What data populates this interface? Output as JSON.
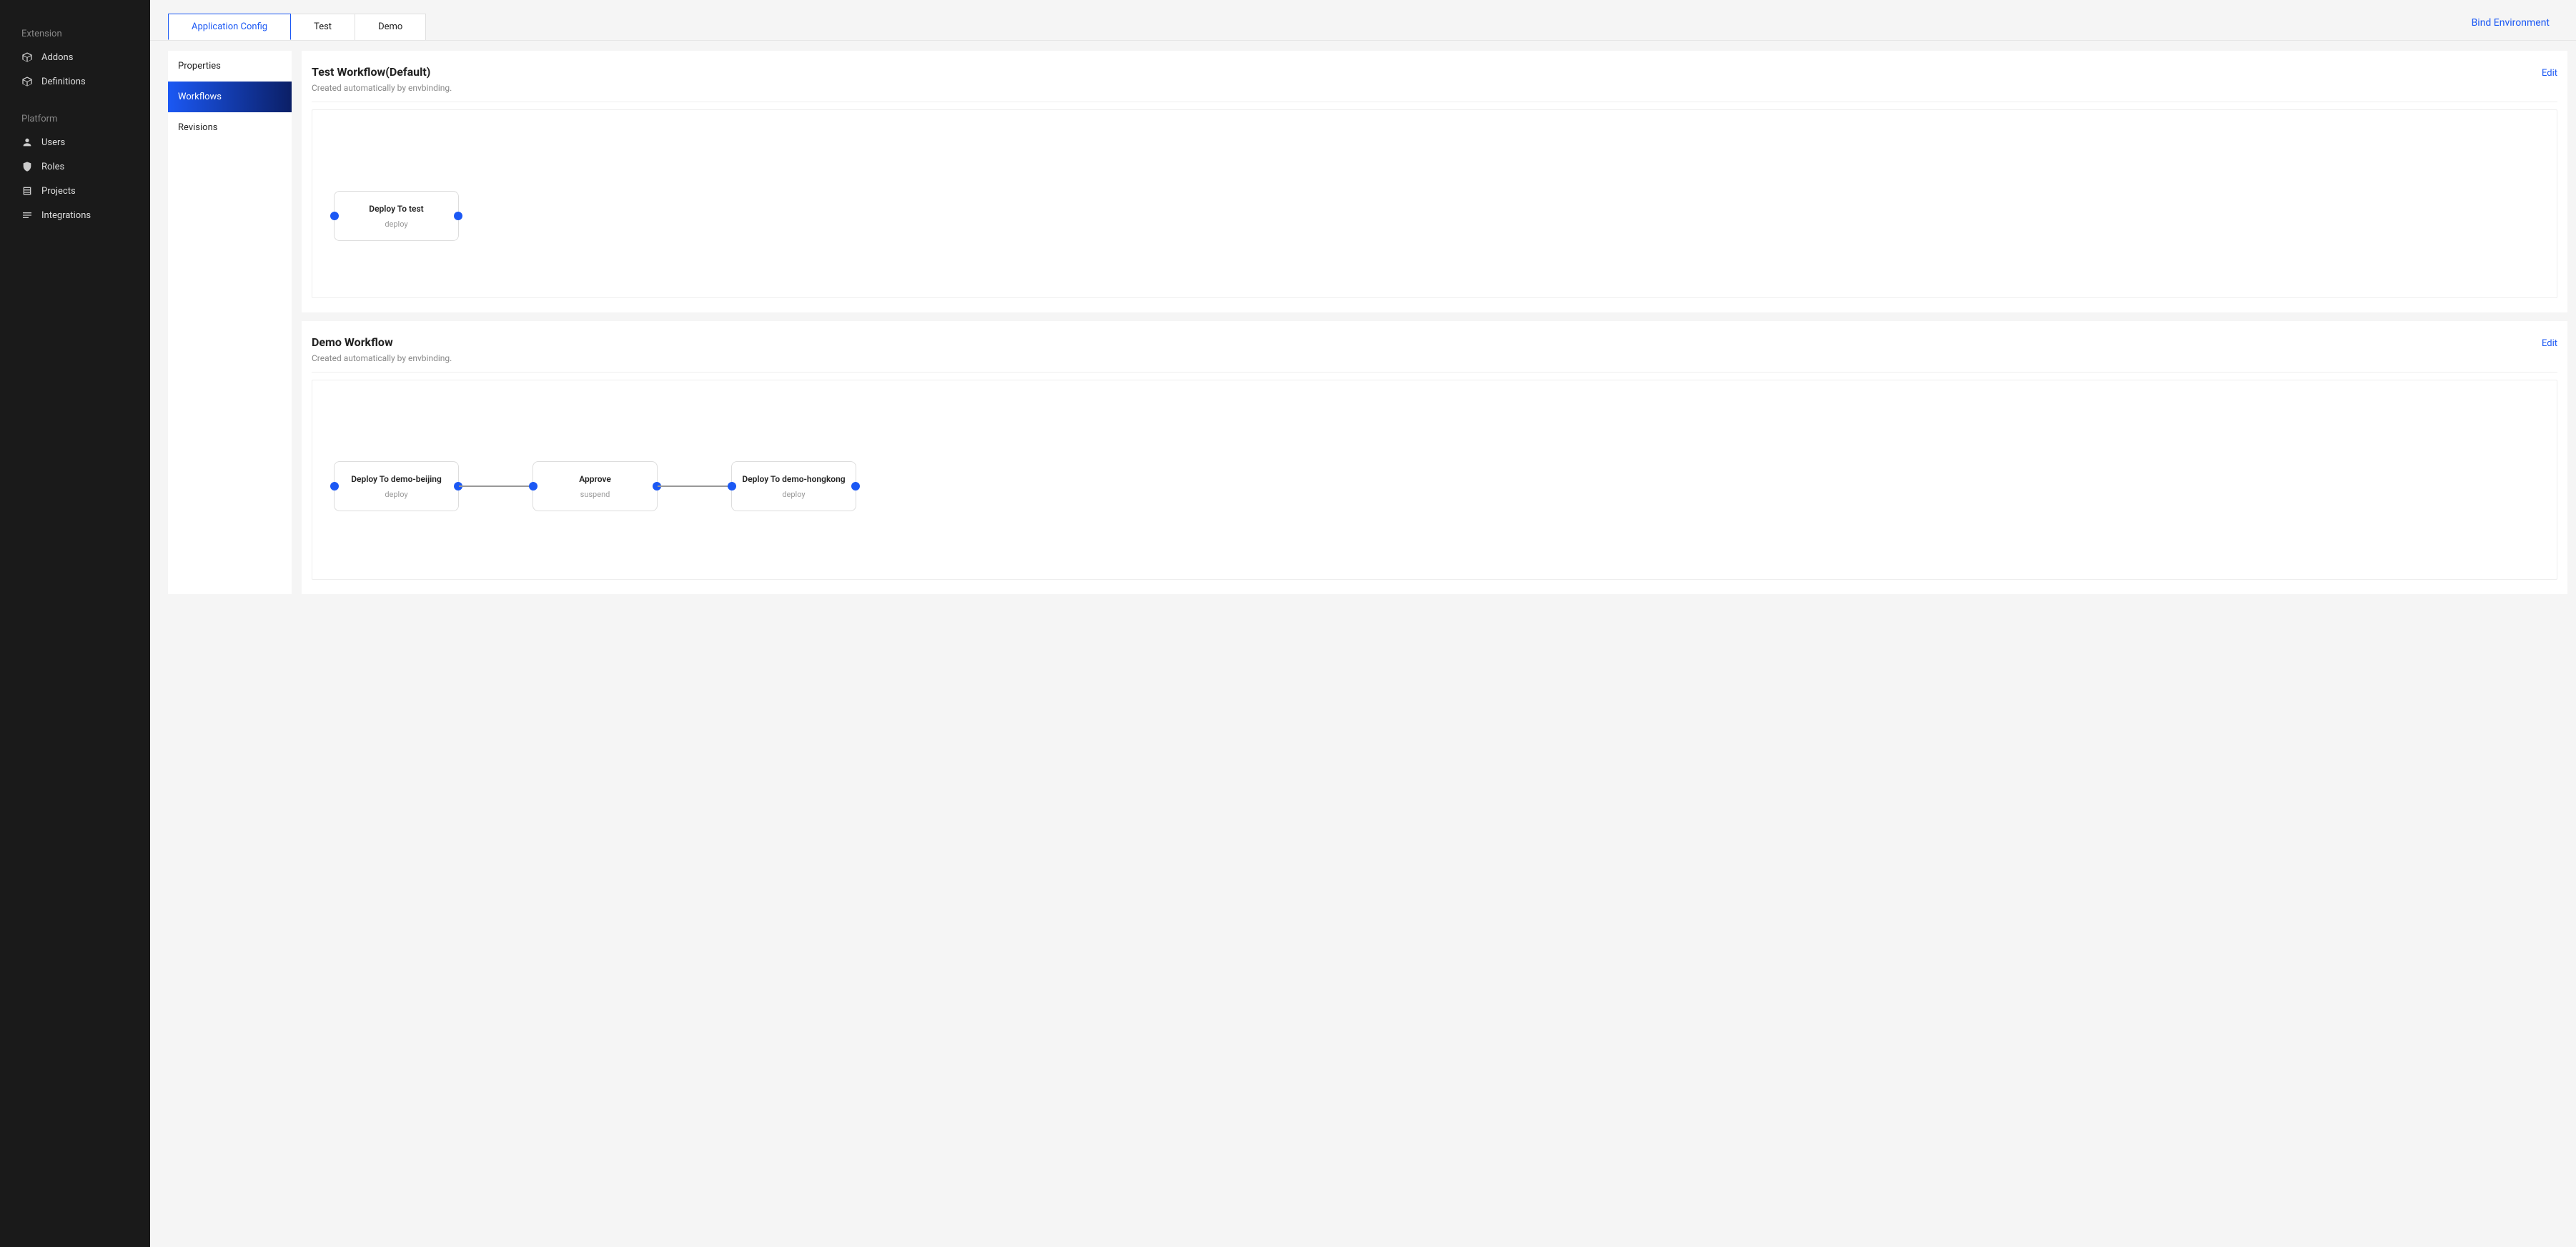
{
  "sidebar": {
    "sections": [
      {
        "label": "Extension",
        "items": [
          {
            "label": "Addons",
            "icon": "cube"
          },
          {
            "label": "Definitions",
            "icon": "cube"
          }
        ]
      },
      {
        "label": "Platform",
        "items": [
          {
            "label": "Users",
            "icon": "users"
          },
          {
            "label": "Roles",
            "icon": "shield"
          },
          {
            "label": "Projects",
            "icon": "list-box"
          },
          {
            "label": "Integrations",
            "icon": "lines"
          }
        ]
      }
    ]
  },
  "tabs": {
    "items": [
      {
        "label": "Application Config",
        "active": true
      },
      {
        "label": "Test",
        "active": false
      },
      {
        "label": "Demo",
        "active": false
      }
    ],
    "bind_env_label": "Bind Environment"
  },
  "subnav": {
    "items": [
      {
        "label": "Properties",
        "active": false
      },
      {
        "label": "Workflows",
        "active": true
      },
      {
        "label": "Revisions",
        "active": false
      }
    ]
  },
  "workflows": [
    {
      "title": "Test Workflow(Default)",
      "subtitle": "Created automatically by envbinding.",
      "edit_label": "Edit",
      "nodes": [
        {
          "title": "Deploy To test",
          "type": "deploy"
        }
      ]
    },
    {
      "title": "Demo Workflow",
      "subtitle": "Created automatically by envbinding.",
      "edit_label": "Edit",
      "nodes": [
        {
          "title": "Deploy To demo-beijing",
          "type": "deploy"
        },
        {
          "title": "Approve",
          "type": "suspend"
        },
        {
          "title": "Deploy To demo-hongkong",
          "type": "deploy"
        }
      ]
    }
  ]
}
